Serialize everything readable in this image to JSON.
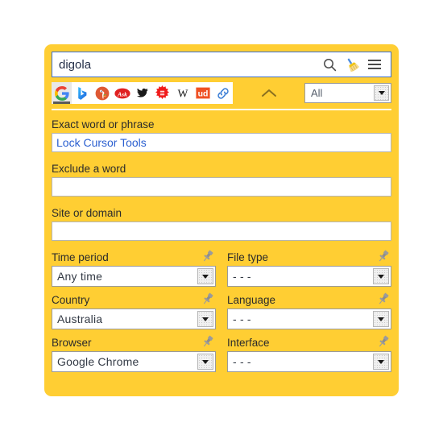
{
  "panel": {
    "background_color": "#FFCE33"
  },
  "search": {
    "query": "digola",
    "placeholder": "",
    "icons": [
      {
        "name": "search-icon",
        "title": "Search"
      },
      {
        "name": "broom-clear-icon",
        "title": "Clear"
      },
      {
        "name": "hamburger-menu-icon",
        "title": "Menu"
      }
    ]
  },
  "engines": [
    {
      "name": "google",
      "label": "Google",
      "selected": true
    },
    {
      "name": "bing",
      "label": "Bing",
      "selected": false
    },
    {
      "name": "duckduckgo",
      "label": "DuckDuckGo",
      "selected": false
    },
    {
      "name": "ask",
      "label": "Ask",
      "selected": false
    },
    {
      "name": "bird",
      "label": "Bird",
      "selected": false
    },
    {
      "name": "sun-star",
      "label": "Sun",
      "selected": false
    },
    {
      "name": "wikipedia",
      "label": "W",
      "selected": false
    },
    {
      "name": "urban-dictionary",
      "label": "ud",
      "selected": false
    },
    {
      "name": "link",
      "label": "Link",
      "selected": false
    }
  ],
  "collapse": {
    "icon": "chevron-up-icon"
  },
  "scope": {
    "value": "All"
  },
  "text_fields": [
    {
      "label": "Exact word or phrase",
      "value": "Lock Cursor Tools",
      "name": "exact-phrase"
    },
    {
      "label": "Exclude a word",
      "value": "",
      "name": "exclude-word"
    },
    {
      "label": "Site or domain",
      "value": "",
      "name": "site-domain"
    }
  ],
  "dropdowns": [
    {
      "label": "Time period",
      "value": "Any time",
      "name": "time-period"
    },
    {
      "label": "File type",
      "value": "- - -",
      "name": "file-type"
    },
    {
      "label": "Country",
      "value": "Australia",
      "name": "country"
    },
    {
      "label": "Language",
      "value": "- - -",
      "name": "language"
    },
    {
      "label": "Browser",
      "value": "Google Chrome",
      "name": "browser"
    },
    {
      "label": "Interface",
      "value": "- - -",
      "name": "interface"
    }
  ]
}
